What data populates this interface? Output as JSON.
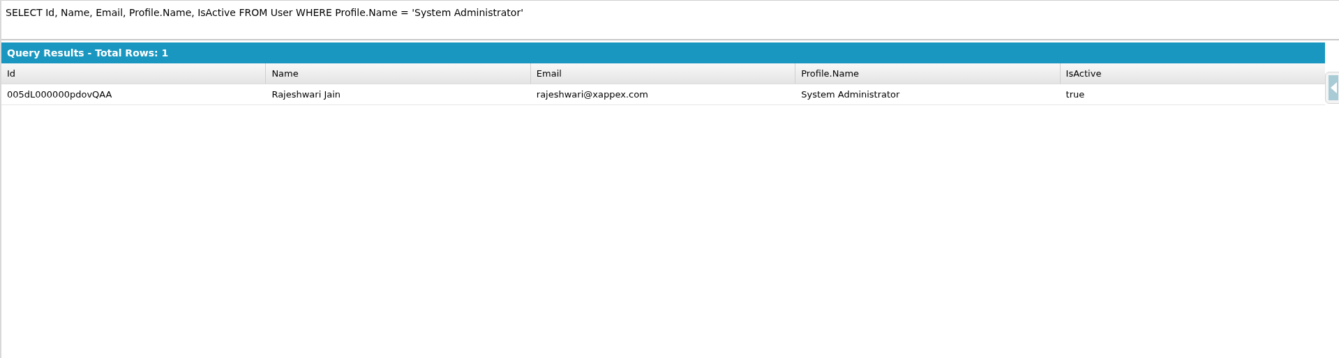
{
  "query": {
    "value": "SELECT Id, Name, Email, Profile.Name, IsActive FROM User WHERE Profile.Name = 'System Administrator'"
  },
  "results": {
    "title": "Query Results - Total Rows: 1",
    "columns": [
      "Id",
      "Name",
      "Email",
      "Profile.Name",
      "IsActive"
    ],
    "rows": [
      [
        "005dL000000pdovQAA",
        "Rajeshwari Jain",
        "rajeshwari@xappex.com",
        "System Administrator",
        "true"
      ]
    ]
  }
}
